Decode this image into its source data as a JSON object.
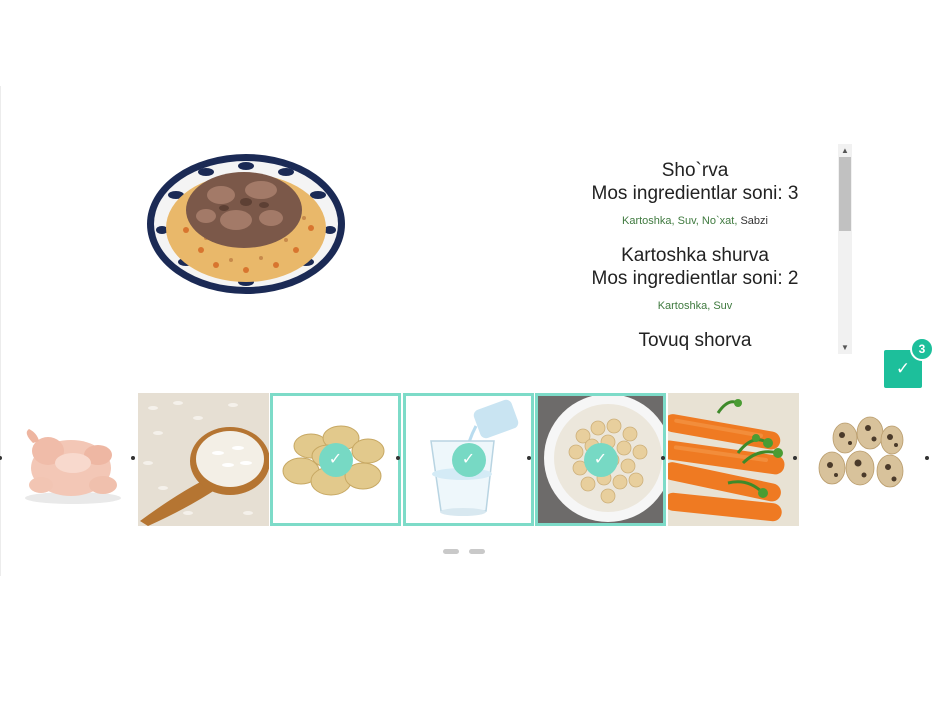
{
  "dish": {
    "name": "plov-image"
  },
  "recipes": [
    {
      "name": "Sho`rva",
      "count_text": "Mos ingredientlar soni: 3",
      "ingredients": [
        {
          "text": "Kartoshka",
          "matched": true
        },
        {
          "text": "Suv",
          "matched": true
        },
        {
          "text": "No`xat",
          "matched": true
        },
        {
          "text": "Sabzi",
          "matched": false
        }
      ]
    },
    {
      "name": "Kartoshka shurva",
      "count_text": "Mos ingredientlar soni: 2",
      "ingredients": [
        {
          "text": "Kartoshka",
          "matched": true
        },
        {
          "text": "Suv",
          "matched": true
        }
      ]
    },
    {
      "name": "Tovuq shorva",
      "count_text": "",
      "ingredients": []
    }
  ],
  "confirm": {
    "icon": "check-icon",
    "glyph": "✓",
    "badge": "3"
  },
  "ingredients_carousel": [
    {
      "name": "chicken",
      "selected": false
    },
    {
      "name": "rice",
      "selected": false
    },
    {
      "name": "potato",
      "selected": true
    },
    {
      "name": "water",
      "selected": true
    },
    {
      "name": "chickpeas",
      "selected": true
    },
    {
      "name": "carrot",
      "selected": false
    },
    {
      "name": "quail-eggs",
      "selected": false
    }
  ],
  "check_glyph": "✓",
  "scroll": {
    "up": "▲",
    "down": "▼"
  },
  "colors": {
    "accent": "#1dbf9b",
    "selected_border": "#7ddbc8",
    "matched_ingredient": "#3f7a3f"
  },
  "pagination": {
    "pages": 2,
    "active": 1
  }
}
